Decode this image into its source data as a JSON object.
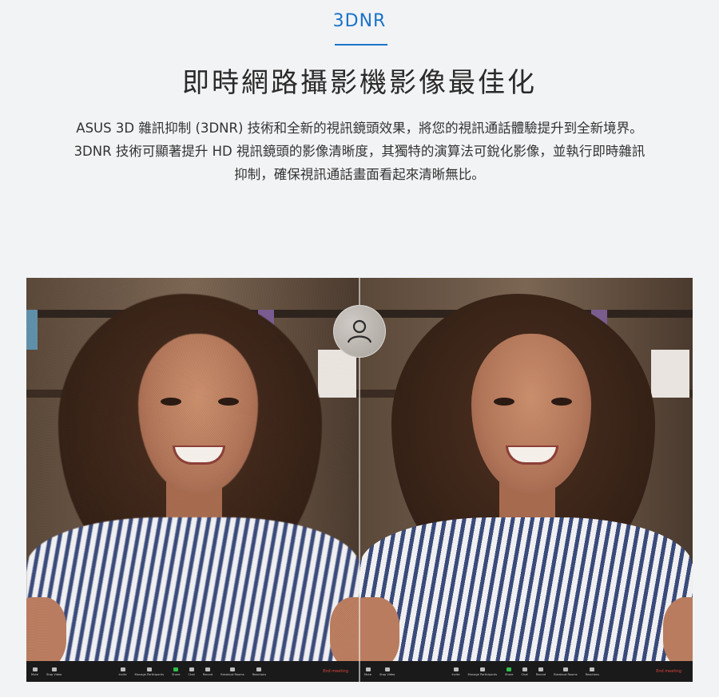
{
  "header": {
    "tag": "3DNR",
    "title": "即時網路攝影機影像最佳化",
    "description": "ASUS 3D 雜訊抑制 (3DNR) 技術和全新的視訊鏡頭效果，將您的視訊通話體驗提升到全新境界。3DNR 技術可顯著提升 HD 視訊鏡頭的影像清晰度，其獨特的演算法可銳化影像，並執行即時雜訊抑制，確保視訊通話畫面看起來清晰無比。"
  },
  "colors": {
    "accent": "#1a73c8",
    "toolbar_bg": "#1a1a1a",
    "end_meeting": "#e0463d",
    "share_green": "#2fbf4a"
  },
  "comparison": {
    "handle_icon": "user-icon",
    "toolbar": {
      "items": [
        {
          "label": "Mute",
          "icon": "microphone-icon"
        },
        {
          "label": "Stop Video",
          "icon": "video-camera-icon"
        },
        {
          "label": "Invite",
          "icon": "invite-icon"
        },
        {
          "label": "Manage Participants",
          "icon": "participants-icon"
        },
        {
          "label": "Share",
          "icon": "share-screen-icon"
        },
        {
          "label": "Chat",
          "icon": "chat-icon"
        },
        {
          "label": "Record",
          "icon": "record-icon"
        },
        {
          "label": "Breakout Rooms",
          "icon": "breakout-rooms-icon"
        },
        {
          "label": "Reactions",
          "icon": "reactions-icon"
        }
      ],
      "end_label": "End meeting"
    }
  }
}
